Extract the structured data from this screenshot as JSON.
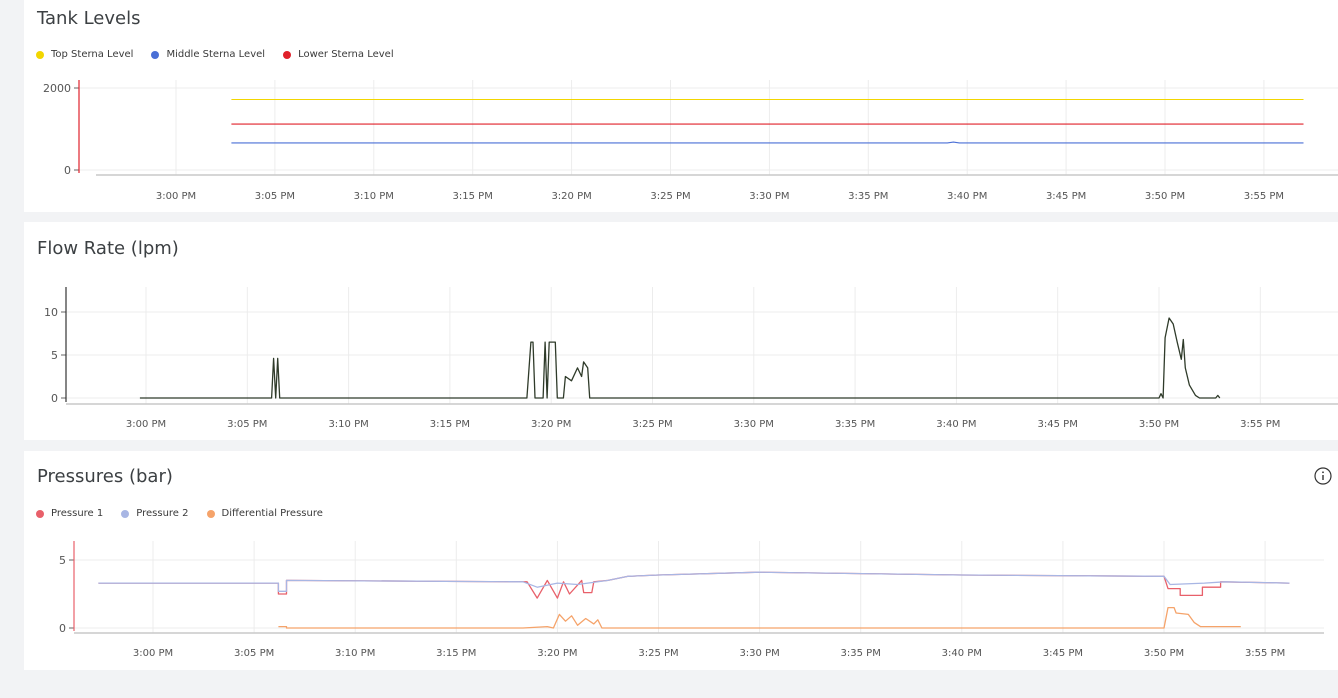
{
  "x_ticks": [
    "3:00 PM",
    "3:05 PM",
    "3:10 PM",
    "3:15 PM",
    "3:20 PM",
    "3:25 PM",
    "3:30 PM",
    "3:35 PM",
    "3:40 PM",
    "3:45 PM",
    "3:50 PM",
    "3:55 PM"
  ],
  "chart_data": [
    {
      "type": "line",
      "title": "Tank Levels",
      "xlabel": "",
      "ylabel": "",
      "x_range": [
        "2:57 PM",
        "3:56 PM"
      ],
      "ylim": [
        0,
        2000
      ],
      "y_ticks": [
        0,
        2000
      ],
      "legend_position": "top-left",
      "grid": true,
      "series": [
        {
          "name": "Top Sterna Level",
          "color": "#f2d600",
          "points": [
            [
              2.8,
              1720
            ],
            [
              57.0,
              1720
            ]
          ]
        },
        {
          "name": "Middle Sterna Level",
          "color": "#4a6fd6",
          "points": [
            [
              2.8,
              660
            ],
            [
              39.0,
              660
            ],
            [
              39.3,
              680
            ],
            [
              39.6,
              660
            ],
            [
              57.0,
              660
            ]
          ]
        },
        {
          "name": "Lower Sterna Level",
          "color": "#e0202a",
          "points": [
            [
              2.8,
              1120
            ],
            [
              57.0,
              1120
            ]
          ]
        }
      ]
    },
    {
      "type": "line",
      "title": "Flow Rate (lpm)",
      "xlabel": "",
      "ylabel": "",
      "ylim": [
        0,
        12
      ],
      "y_ticks": [
        0,
        5,
        10
      ],
      "grid": true,
      "series": [
        {
          "name": "",
          "color": "#2f3b2a",
          "points": [
            [
              -0.3,
              0
            ],
            [
              6.2,
              0
            ],
            [
              6.3,
              4.6
            ],
            [
              6.4,
              0
            ],
            [
              6.5,
              4.6
            ],
            [
              6.6,
              0
            ],
            [
              18.8,
              0
            ],
            [
              19.0,
              6.5
            ],
            [
              19.1,
              6.5
            ],
            [
              19.2,
              0
            ],
            [
              19.6,
              0
            ],
            [
              19.7,
              6.5
            ],
            [
              19.8,
              0
            ],
            [
              19.9,
              6.5
            ],
            [
              20.2,
              6.5
            ],
            [
              20.3,
              0
            ],
            [
              20.6,
              0
            ],
            [
              20.7,
              2.5
            ],
            [
              21.0,
              2
            ],
            [
              21.3,
              3.5
            ],
            [
              21.5,
              2.5
            ],
            [
              21.6,
              4.2
            ],
            [
              21.8,
              3.5
            ],
            [
              21.9,
              0
            ],
            [
              50.0,
              0
            ],
            [
              50.1,
              0.5
            ],
            [
              50.2,
              0
            ],
            [
              50.3,
              7
            ],
            [
              50.5,
              9.3
            ],
            [
              50.7,
              8.6
            ],
            [
              50.9,
              6.5
            ],
            [
              51.1,
              4.5
            ],
            [
              51.2,
              6.8
            ],
            [
              51.3,
              3.5
            ],
            [
              51.5,
              1.5
            ],
            [
              51.8,
              0.3
            ],
            [
              52.0,
              0
            ],
            [
              52.8,
              0
            ],
            [
              52.9,
              0.3
            ],
            [
              53.0,
              0
            ]
          ]
        }
      ]
    },
    {
      "type": "line",
      "title": "Pressures (bar)",
      "xlabel": "",
      "ylabel": "",
      "ylim": [
        0,
        6
      ],
      "y_ticks": [
        0,
        5
      ],
      "legend_position": "top-left",
      "grid": true,
      "series": [
        {
          "name": "Pressure 1",
          "color": "#e8606a",
          "points": [
            [
              -2.7,
              3.3
            ],
            [
              6.2,
              3.3
            ],
            [
              6.2,
              2.5
            ],
            [
              6.6,
              2.5
            ],
            [
              6.6,
              3.5
            ],
            [
              18.3,
              3.4
            ],
            [
              18.5,
              3.4
            ],
            [
              19.0,
              2.2
            ],
            [
              19.5,
              3.5
            ],
            [
              20.0,
              2.2
            ],
            [
              20.3,
              3.4
            ],
            [
              20.6,
              2.5
            ],
            [
              21.2,
              3.5
            ],
            [
              21.3,
              2.6
            ],
            [
              21.7,
              2.6
            ],
            [
              21.8,
              3.4
            ],
            [
              22.5,
              3.5
            ],
            [
              23.5,
              3.8
            ],
            [
              25.0,
              3.9
            ],
            [
              30.0,
              4.1
            ],
            [
              40.0,
              3.9
            ],
            [
              50.0,
              3.8
            ],
            [
              50.2,
              2.9
            ],
            [
              50.8,
              2.9
            ],
            [
              50.8,
              2.4
            ],
            [
              51.9,
              2.4
            ],
            [
              51.9,
              3.0
            ],
            [
              52.8,
              3.0
            ],
            [
              52.8,
              3.4
            ],
            [
              56.2,
              3.3
            ]
          ]
        },
        {
          "name": "Pressure 2",
          "color": "#a8b6e4",
          "points": [
            [
              -2.7,
              3.3
            ],
            [
              6.2,
              3.3
            ],
            [
              6.2,
              2.7
            ],
            [
              6.6,
              2.7
            ],
            [
              6.6,
              3.5
            ],
            [
              18.3,
              3.4
            ],
            [
              19.0,
              3.0
            ],
            [
              20.0,
              3.3
            ],
            [
              21.0,
              3.2
            ],
            [
              22.5,
              3.5
            ],
            [
              23.5,
              3.8
            ],
            [
              25.0,
              3.9
            ],
            [
              30.0,
              4.1
            ],
            [
              40.0,
              3.9
            ],
            [
              50.0,
              3.8
            ],
            [
              50.3,
              3.2
            ],
            [
              52.0,
              3.3
            ],
            [
              53.0,
              3.4
            ],
            [
              56.2,
              3.3
            ]
          ]
        },
        {
          "name": "Differential Pressure",
          "color": "#f5a36a",
          "points": [
            [
              6.2,
              0.1
            ],
            [
              6.6,
              0.1
            ],
            [
              6.6,
              0
            ],
            [
              18.3,
              0
            ],
            [
              19.5,
              0.1
            ],
            [
              19.8,
              0
            ],
            [
              20.1,
              1.0
            ],
            [
              20.4,
              0.5
            ],
            [
              20.7,
              0.9
            ],
            [
              21.0,
              0.2
            ],
            [
              21.4,
              0.7
            ],
            [
              21.8,
              0.3
            ],
            [
              22.0,
              0.6
            ],
            [
              22.2,
              0
            ],
            [
              50.0,
              0
            ],
            [
              50.2,
              1.5
            ],
            [
              50.5,
              1.5
            ],
            [
              50.6,
              1.1
            ],
            [
              51.2,
              1.0
            ],
            [
              51.5,
              0.4
            ],
            [
              51.8,
              0.1
            ],
            [
              53.8,
              0.1
            ]
          ]
        }
      ]
    }
  ]
}
